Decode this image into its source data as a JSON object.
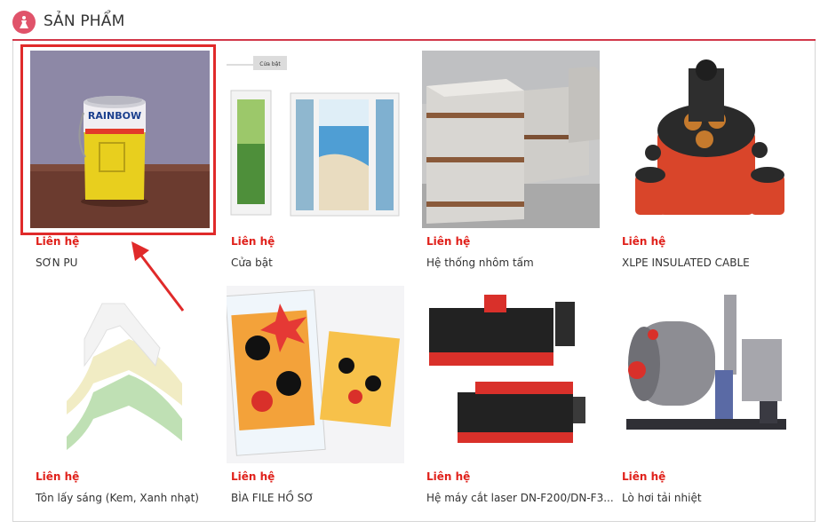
{
  "section": {
    "title": "SẢN PHẨM",
    "icon": "dress-icon"
  },
  "products": [
    {
      "price": "Liên hệ",
      "name": "SƠN PU"
    },
    {
      "price": "Liên hệ",
      "name": "Cửa bật",
      "image_caption": "Cửa bật"
    },
    {
      "price": "Liên hệ",
      "name": "Hệ thống nhôm tấm"
    },
    {
      "price": "Liên hệ",
      "name": "XLPE INSULATED CABLE"
    },
    {
      "price": "Liên hệ",
      "name": "Tôn lấy sáng (Kem, Xanh nhạt)"
    },
    {
      "price": "Liên hệ",
      "name": "BÌA FILE HỒ SƠ"
    },
    {
      "price": "Liên hệ",
      "name": "Hệ máy cắt laser DN-F200/DN-F3..."
    },
    {
      "price": "Liên hệ",
      "name": "Lò hơi tải nhiệt"
    }
  ],
  "paint_can_label": "RAINBOW",
  "colors": {
    "accent": "#d2384a",
    "price": "#e0211b",
    "highlight": "#e02a2a"
  }
}
